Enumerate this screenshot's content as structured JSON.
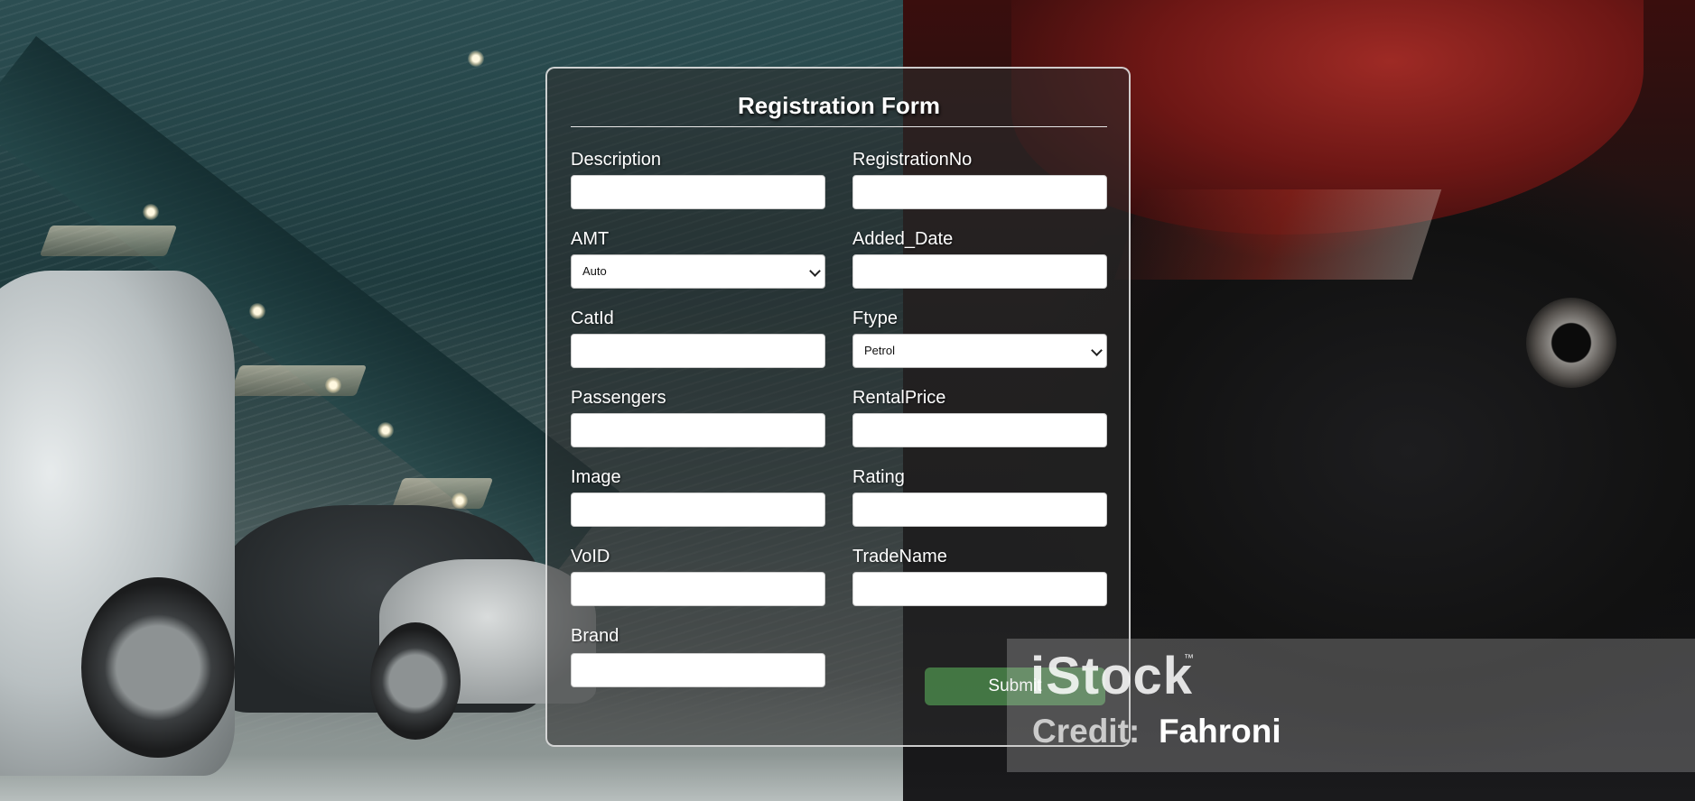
{
  "form": {
    "title": "Registration Form",
    "submit_label": "Submit",
    "fields": {
      "description": {
        "label": "Description",
        "value": ""
      },
      "registration_no": {
        "label": "RegistrationNo",
        "value": ""
      },
      "amt": {
        "label": "AMT",
        "selected": "Auto"
      },
      "added_date": {
        "label": "Added_Date",
        "value": ""
      },
      "cat_id": {
        "label": "CatId",
        "value": ""
      },
      "ftype": {
        "label": "Ftype",
        "selected": "Petrol"
      },
      "passengers": {
        "label": "Passengers",
        "value": ""
      },
      "rental_price": {
        "label": "RentalPrice",
        "value": ""
      },
      "image": {
        "label": "Image",
        "value": ""
      },
      "rating": {
        "label": "Rating",
        "value": ""
      },
      "vo_id": {
        "label": "VoID",
        "value": ""
      },
      "trade_name": {
        "label": "TradeName",
        "value": ""
      },
      "brand": {
        "label": "Brand",
        "value": ""
      }
    }
  },
  "watermark": {
    "logo": "iStock",
    "trademark": "™",
    "credit_label": "Credit:",
    "credit_name": "Fahroni"
  },
  "colors": {
    "submit_button": "#4c8c4c",
    "card_border": "#ebebeb"
  }
}
